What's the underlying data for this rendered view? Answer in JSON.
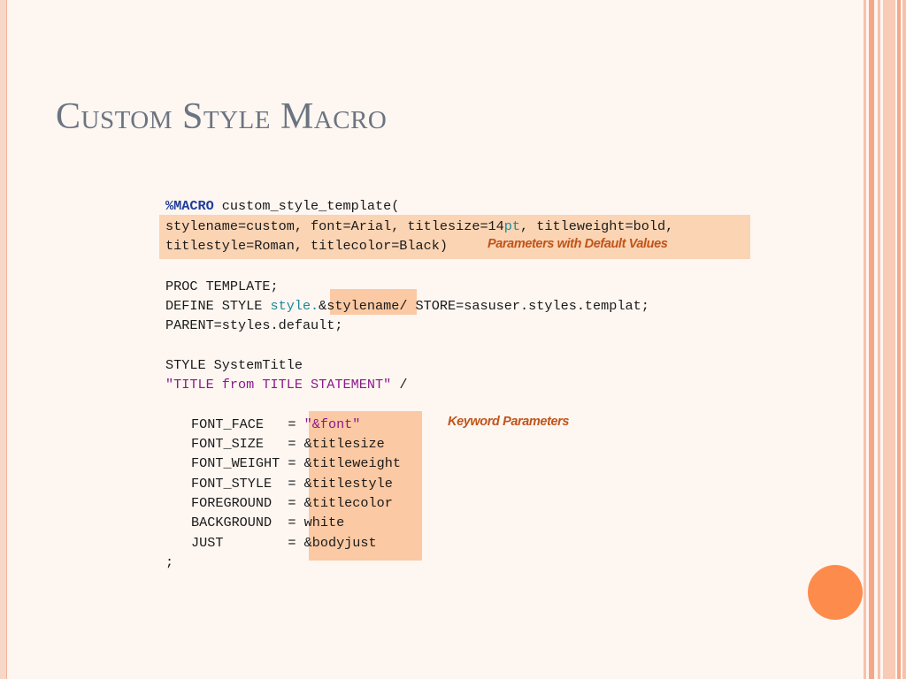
{
  "slide": {
    "title": "Custom Style Macro",
    "notes": {
      "default_params": "Parameters with Default Values",
      "keyword_params": "Keyword Parameters"
    },
    "code": {
      "macro_kw": "%MACRO",
      "macro_name": " custom_style_template(",
      "params_line1a": "stylename=custom, font=Arial, titlesize=14",
      "params_line1b": "pt",
      "params_line1c": ", titleweight=bold,",
      "params_line2": "titlestyle=Roman, titlecolor=Black)",
      "proc": "PROC TEMPLATE;",
      "define_a": "DEFINE STYLE ",
      "define_b": "style.",
      "define_c": "&stylename",
      "define_d": "/ STORE=sasuser.styles.templat;",
      "parent": "PARENT=styles.default;",
      "style_line": "STYLE SystemTitle",
      "style_string": "\"TITLE from TITLE STATEMENT\"",
      "style_slash": " /",
      "attributes": [
        {
          "name": "FONT_FACE   = ",
          "value": "\"&font\""
        },
        {
          "name": "FONT_SIZE   = ",
          "value": "&titlesize"
        },
        {
          "name": "FONT_WEIGHT = ",
          "value": "&titleweight"
        },
        {
          "name": "FONT_STYLE  = ",
          "value": "&titlestyle"
        },
        {
          "name": "FOREGROUND  = ",
          "value": "&titlecolor"
        },
        {
          "name": "BACKGROUND  = ",
          "value": "white"
        },
        {
          "name": "JUST        = ",
          "value": "&bodyjust"
        }
      ],
      "end": ";"
    }
  },
  "colors": {
    "background": "#fdf6f1",
    "title": "#6c7480",
    "highlight": "#fbd4b4",
    "note": "#c0541a",
    "accent_dot": "#fd8b4c",
    "stripe": "#f4a888"
  }
}
